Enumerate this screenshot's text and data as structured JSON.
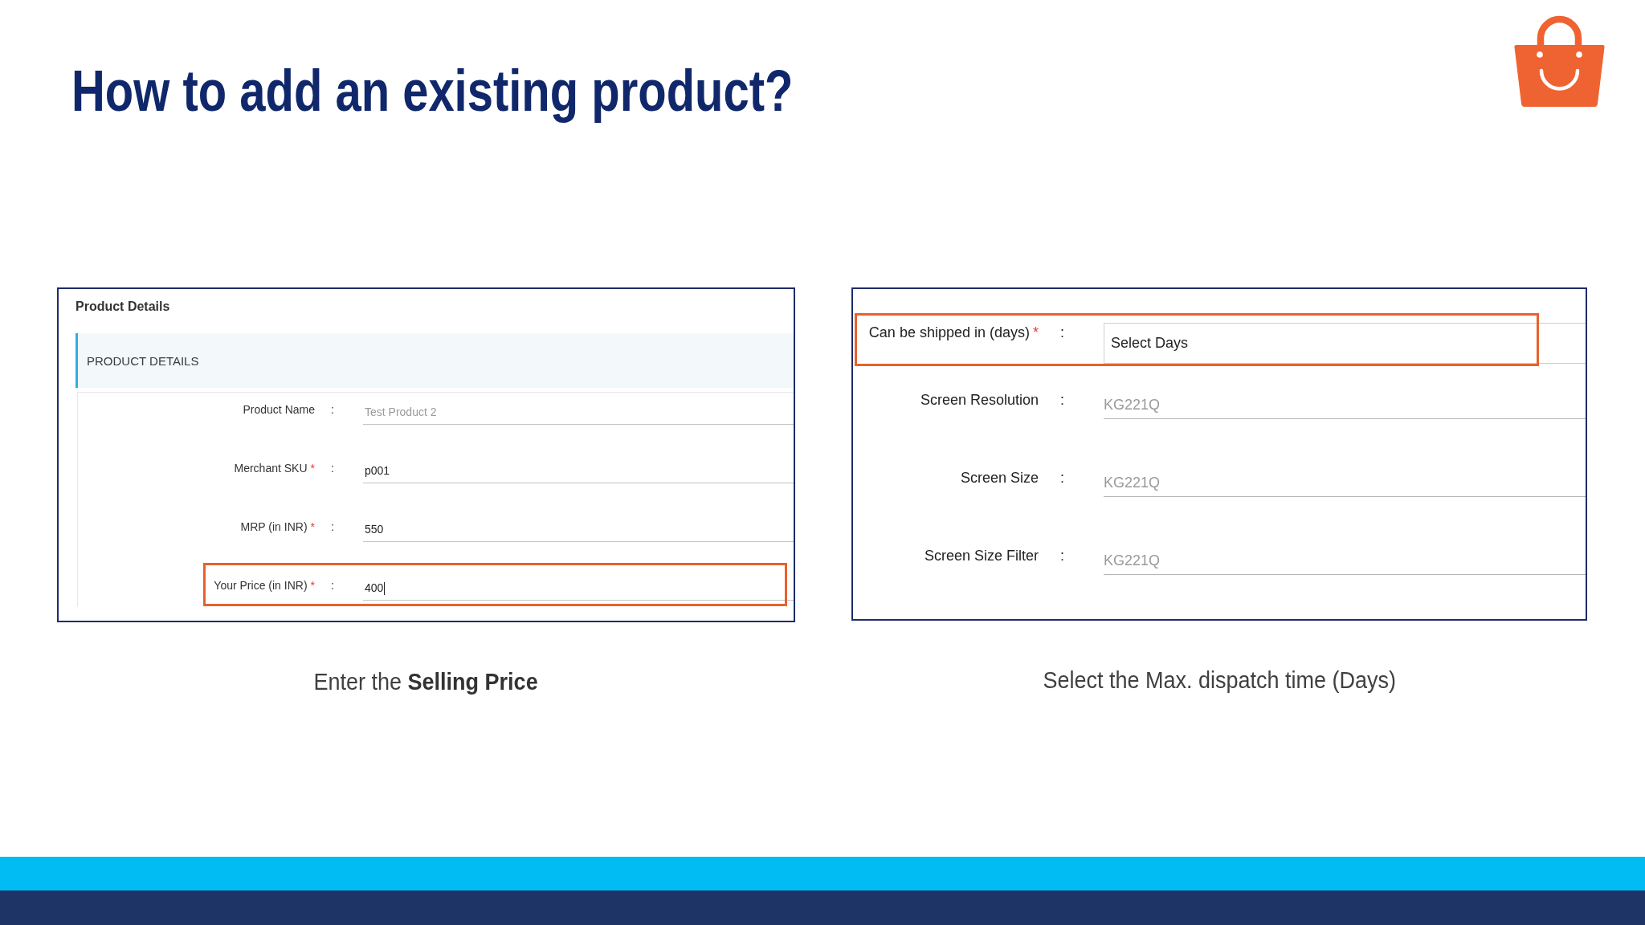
{
  "slide": {
    "title": "How to add an existing product?"
  },
  "panels": [
    {
      "kind": "details",
      "heading": "Product Details",
      "section_title": "PRODUCT DETAILS",
      "fields": [
        {
          "kind": "text",
          "label": "Product Name",
          "separator": ":",
          "value": "Test Product 2",
          "disabled": true,
          "focused": false,
          "highlighted": false
        },
        {
          "kind": "text",
          "label": "Merchant SKU",
          "required_mark": "*",
          "separator": ":",
          "value": "p001",
          "disabled": false,
          "focused": false,
          "highlighted": false
        },
        {
          "kind": "text",
          "label": "MRP (in INR)",
          "required_mark": "*",
          "separator": ":",
          "value": "550",
          "disabled": false,
          "focused": false,
          "highlighted": false
        },
        {
          "kind": "text",
          "label": "Your Price (in INR)",
          "required_mark": "*",
          "separator": ":",
          "value": "400",
          "disabled": false,
          "focused": true,
          "highlighted": true
        }
      ],
      "caption": "Enter the **Selling Price**"
    },
    {
      "kind": "attributes",
      "fields": [
        {
          "kind": "select",
          "label": "Can be shipped in (days)",
          "required_mark": "*",
          "separator": ":",
          "value": "Select Days",
          "highlighted": true
        },
        {
          "kind": "text",
          "label": "Screen Resolution",
          "separator": ":",
          "value": "KG221Q",
          "disabled": true,
          "focused": false,
          "highlighted": false
        },
        {
          "kind": "text",
          "label": "Screen Size",
          "separator": ":",
          "value": "KG221Q",
          "disabled": true,
          "focused": false,
          "highlighted": false
        },
        {
          "kind": "text",
          "label": "Screen Size Filter",
          "separator": ":",
          "value": "KG221Q",
          "disabled": true,
          "focused": false,
          "highlighted": false
        }
      ],
      "caption": "Select the Max. dispatch time (Days)"
    }
  ]
}
